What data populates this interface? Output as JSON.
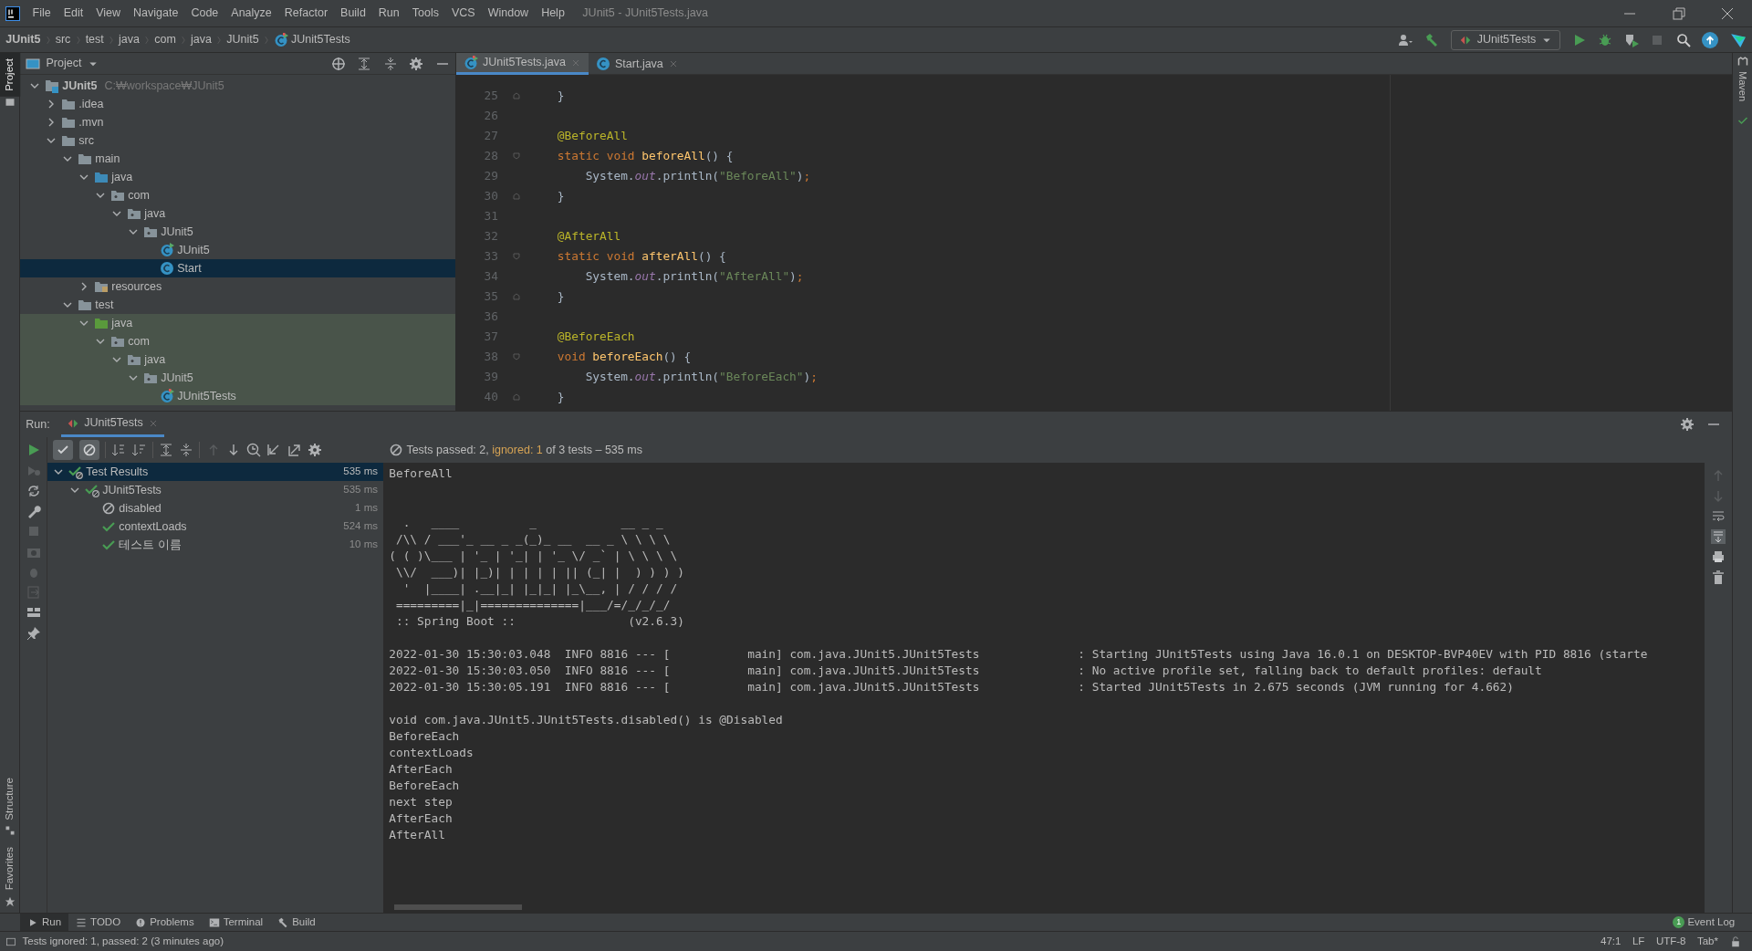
{
  "window": {
    "title": "JUnit5 - JUnit5Tests.java"
  },
  "menu": [
    "File",
    "Edit",
    "View",
    "Navigate",
    "Code",
    "Analyze",
    "Refactor",
    "Build",
    "Run",
    "Tools",
    "VCS",
    "Window",
    "Help"
  ],
  "breadcrumbs": [
    {
      "label": "JUnit5",
      "kind": "module"
    },
    {
      "label": "src",
      "kind": "folder"
    },
    {
      "label": "test",
      "kind": "folder"
    },
    {
      "label": "java",
      "kind": "folder"
    },
    {
      "label": "com",
      "kind": "folder"
    },
    {
      "label": "java",
      "kind": "folder"
    },
    {
      "label": "JUnit5",
      "kind": "folder"
    },
    {
      "label": "JUnit5Tests",
      "kind": "test-class"
    }
  ],
  "run_config": "JUnit5Tests",
  "left_strip": [
    {
      "label": "Project",
      "selected": true,
      "kind": "project"
    },
    {
      "label": "Structure",
      "selected": false,
      "kind": "structure"
    },
    {
      "label": "Favorites",
      "selected": false,
      "kind": "favorites"
    }
  ],
  "right_strip": [
    {
      "label": "Maven"
    }
  ],
  "project_panel": {
    "title": "Project",
    "tree": [
      {
        "label": "JUnit5",
        "path": "C:₩workspace₩JUnit5",
        "kind": "module",
        "expanded": true,
        "selected": false,
        "children": [
          {
            "label": ".idea",
            "kind": "folder",
            "expanded": false,
            "selected": false
          },
          {
            "label": ".mvn",
            "kind": "folder",
            "expanded": false,
            "selected": false
          },
          {
            "label": "src",
            "kind": "folder",
            "expanded": true,
            "selected": false,
            "children": [
              {
                "label": "main",
                "kind": "folder",
                "expanded": true,
                "selected": false,
                "children": [
                  {
                    "label": "java",
                    "kind": "source-root",
                    "expanded": true,
                    "selected": false,
                    "children": [
                      {
                        "label": "com",
                        "kind": "package",
                        "expanded": true,
                        "selected": false,
                        "children": [
                          {
                            "label": "java",
                            "kind": "package",
                            "expanded": true,
                            "selected": false,
                            "children": [
                              {
                                "label": "JUnit5",
                                "kind": "package",
                                "expanded": true,
                                "selected": false,
                                "children": [
                                  {
                                    "label": "JUnit5",
                                    "kind": "run-class",
                                    "selected": false
                                  },
                                  {
                                    "label": "Start",
                                    "kind": "class",
                                    "selected": true
                                  }
                                ]
                              }
                            ]
                          }
                        ]
                      }
                    ]
                  },
                  {
                    "label": "resources",
                    "kind": "resources",
                    "expanded": false,
                    "selected": false
                  }
                ]
              },
              {
                "label": "test",
                "kind": "folder",
                "expanded": true,
                "selected": false,
                "children": [
                  {
                    "label": "java",
                    "kind": "test-root",
                    "expanded": true,
                    "selected": false,
                    "children": [
                      {
                        "label": "com",
                        "kind": "package",
                        "expanded": true,
                        "selected": false,
                        "children": [
                          {
                            "label": "java",
                            "kind": "package",
                            "expanded": true,
                            "selected": false,
                            "children": [
                              {
                                "label": "JUnit5",
                                "kind": "package",
                                "expanded": true,
                                "selected": false,
                                "children": [
                                  {
                                    "label": "JUnit5Tests",
                                    "kind": "test-class",
                                    "selected": false
                                  }
                                ]
                              }
                            ]
                          }
                        ]
                      }
                    ]
                  }
                ]
              }
            ]
          }
        ]
      }
    ]
  },
  "editor": {
    "tabs": [
      {
        "label": "JUnit5Tests.java",
        "kind": "test-class",
        "selected": true
      },
      {
        "label": "Start.java",
        "kind": "class",
        "selected": false
      }
    ],
    "lines": [
      {
        "number": "25",
        "kind": "fold-end",
        "tokens": [
          {
            "t": "    }",
            "kind": "plain"
          }
        ]
      },
      {
        "number": "26",
        "kind": "plain"
      },
      {
        "number": "27",
        "kind": "plain",
        "tokens": [
          {
            "t": "    @BeforeAll",
            "kind": "annotation"
          }
        ]
      },
      {
        "number": "28",
        "kind": "fold-start",
        "tokens": [
          {
            "t": "    static void ",
            "kind": "keyword"
          },
          {
            "t": "beforeAll",
            "kind": "method"
          },
          {
            "t": "() {",
            "kind": "plain"
          }
        ]
      },
      {
        "number": "29",
        "kind": "plain",
        "tokens": [
          {
            "t": "        System.",
            "kind": "plain"
          },
          {
            "t": "out",
            "kind": "field"
          },
          {
            "t": ".println(",
            "kind": "plain"
          },
          {
            "t": "\"BeforeAll\"",
            "kind": "string"
          },
          {
            "t": ")",
            "kind": "plain"
          },
          {
            "t": ";",
            "kind": "keyword"
          }
        ]
      },
      {
        "number": "30",
        "kind": "fold-end",
        "tokens": [
          {
            "t": "    }",
            "kind": "plain"
          }
        ]
      },
      {
        "number": "31",
        "kind": "plain"
      },
      {
        "number": "32",
        "kind": "plain",
        "tokens": [
          {
            "t": "    @AfterAll",
            "kind": "annotation"
          }
        ]
      },
      {
        "number": "33",
        "kind": "fold-start",
        "tokens": [
          {
            "t": "    static void ",
            "kind": "keyword"
          },
          {
            "t": "afterAll",
            "kind": "method"
          },
          {
            "t": "() {",
            "kind": "plain"
          }
        ]
      },
      {
        "number": "34",
        "kind": "plain",
        "tokens": [
          {
            "t": "        System.",
            "kind": "plain"
          },
          {
            "t": "out",
            "kind": "field"
          },
          {
            "t": ".println(",
            "kind": "plain"
          },
          {
            "t": "\"AfterAll\"",
            "kind": "string"
          },
          {
            "t": ")",
            "kind": "plain"
          },
          {
            "t": ";",
            "kind": "keyword"
          }
        ]
      },
      {
        "number": "35",
        "kind": "fold-end",
        "tokens": [
          {
            "t": "    }",
            "kind": "plain"
          }
        ]
      },
      {
        "number": "36",
        "kind": "plain"
      },
      {
        "number": "37",
        "kind": "plain",
        "tokens": [
          {
            "t": "    @BeforeEach",
            "kind": "annotation"
          }
        ]
      },
      {
        "number": "38",
        "kind": "fold-start",
        "tokens": [
          {
            "t": "    void ",
            "kind": "keyword"
          },
          {
            "t": "beforeEach",
            "kind": "method"
          },
          {
            "t": "() {",
            "kind": "plain"
          }
        ]
      },
      {
        "number": "39",
        "kind": "plain",
        "tokens": [
          {
            "t": "        System.",
            "kind": "plain"
          },
          {
            "t": "out",
            "kind": "field"
          },
          {
            "t": ".println(",
            "kind": "plain"
          },
          {
            "t": "\"BeforeEach\"",
            "kind": "string"
          },
          {
            "t": ")",
            "kind": "plain"
          },
          {
            "t": ";",
            "kind": "keyword"
          }
        ]
      },
      {
        "number": "40",
        "kind": "fold-end",
        "tokens": [
          {
            "t": "    }",
            "kind": "plain"
          }
        ]
      }
    ]
  },
  "run_panel": {
    "label": "Run:",
    "tab": "JUnit5Tests",
    "toggles": [
      {
        "kind": "passed",
        "on": true
      },
      {
        "kind": "ignored",
        "on": true
      }
    ],
    "summary": {
      "passed": "Tests passed: 2,",
      "ignored": "ignored: 1",
      "rest": "of 3 tests – 535 ms"
    },
    "tests": [
      {
        "label": "Test Results",
        "time": "535 ms",
        "kind": "passed-group",
        "expanded": true,
        "selected": true,
        "children": [
          {
            "label": "JUnit5Tests",
            "time": "535 ms",
            "kind": "passed-group",
            "expanded": true,
            "selected": false,
            "children": [
              {
                "label": "disabled",
                "time": "1 ms",
                "kind": "ignored",
                "selected": false
              },
              {
                "label": "contextLoads",
                "time": "524 ms",
                "kind": "passed",
                "selected": false
              },
              {
                "label": "테스트 이름",
                "time": "10 ms",
                "kind": "passed",
                "selected": false
              }
            ]
          }
        ]
      }
    ],
    "console": [
      {
        "kind": "output",
        "text": "BeforeAll"
      },
      {
        "kind": "blank"
      },
      {
        "kind": "blank"
      },
      {
        "kind": "output",
        "text": "  .   ____          _            __ _ _"
      },
      {
        "kind": "output",
        "text": " /\\\\ / ___'_ __ _ _(_)_ __  __ _ \\ \\ \\ \\"
      },
      {
        "kind": "output",
        "text": "( ( )\\___ | '_ | '_| | '_ \\/ _` | \\ \\ \\ \\"
      },
      {
        "kind": "output",
        "text": " \\\\/  ___)| |_)| | | | | || (_| |  ) ) ) )"
      },
      {
        "kind": "output",
        "text": "  '  |____| .__|_| |_|_| |_\\__, | / / / /"
      },
      {
        "kind": "output",
        "text": " =========|_|==============|___/=/_/_/_/"
      },
      {
        "kind": "output",
        "text": " :: Spring Boot ::                (v2.6.3)"
      },
      {
        "kind": "blank"
      },
      {
        "kind": "output",
        "text": "2022-01-30 15:30:03.048  INFO 8816 --- [           main] com.java.JUnit5.JUnit5Tests              : Starting JUnit5Tests using Java 16.0.1 on DESKTOP-BVP40EV with PID 8816 (starte"
      },
      {
        "kind": "output",
        "text": "2022-01-30 15:30:03.050  INFO 8816 --- [           main] com.java.JUnit5.JUnit5Tests              : No active profile set, falling back to default profiles: default"
      },
      {
        "kind": "output",
        "text": "2022-01-30 15:30:05.191  INFO 8816 --- [           main] com.java.JUnit5.JUnit5Tests              : Started JUnit5Tests in 2.675 seconds (JVM running for 4.662)"
      },
      {
        "kind": "blank"
      },
      {
        "kind": "output",
        "text": "void com.java.JUnit5.JUnit5Tests.disabled() is @Disabled"
      },
      {
        "kind": "output",
        "text": "BeforeEach"
      },
      {
        "kind": "output",
        "text": "contextLoads"
      },
      {
        "kind": "output",
        "text": "AfterEach"
      },
      {
        "kind": "output",
        "text": "BeforeEach"
      },
      {
        "kind": "output",
        "text": "next step"
      },
      {
        "kind": "output",
        "text": "AfterEach"
      },
      {
        "kind": "output",
        "text": "AfterAll"
      }
    ]
  },
  "tool_windows": [
    {
      "label": "Run",
      "kind": "run",
      "selected": true
    },
    {
      "label": "TODO",
      "kind": "todo",
      "selected": false
    },
    {
      "label": "Problems",
      "kind": "problems",
      "selected": false
    },
    {
      "label": "Terminal",
      "kind": "terminal",
      "selected": false
    },
    {
      "label": "Build",
      "kind": "build",
      "selected": false
    }
  ],
  "event_log": {
    "label": "Event Log",
    "count": "1"
  },
  "status_bar": {
    "message": "Tests ignored: 1, passed: 2 (3 minutes ago)",
    "position": "47:1",
    "line_separator": "LF",
    "encoding": "UTF-8",
    "indent": "Tab*"
  }
}
